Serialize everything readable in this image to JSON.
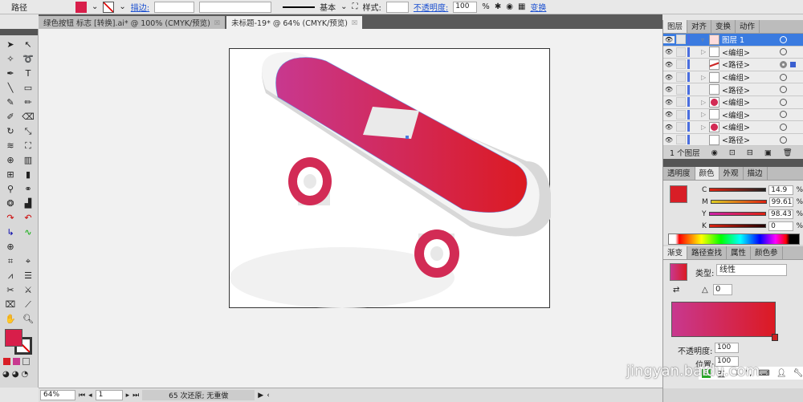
{
  "control_bar": {
    "object_type": "路径",
    "stroke_label": "描边:",
    "stroke_style": "基本",
    "style_label": "样式:",
    "opacity_label": "不透明度:",
    "opacity_value": "100",
    "percent": "%",
    "transform_label": "变换"
  },
  "doc_tabs": [
    {
      "label": "绿色按钮 标志 [转换].ai* @ 100% (CMYK/预览)",
      "active": false
    },
    {
      "label": "未标题-19* @ 64% (CMYK/预览)",
      "active": true
    }
  ],
  "layers_panel": {
    "tabs": [
      "图层",
      "对齐",
      "变换",
      "动作"
    ],
    "items": [
      "图层 1",
      "<编组>",
      "<路径>",
      "<编组>",
      "<路径>",
      "<编组>",
      "<编组>",
      "<编组>",
      "<路径>"
    ],
    "footer": "1 个图层"
  },
  "color_panel": {
    "tabs": [
      "透明度",
      "颜色",
      "外观",
      "描边"
    ],
    "channels": [
      {
        "label": "C",
        "value": "14.9"
      },
      {
        "label": "M",
        "value": "99.61"
      },
      {
        "label": "Y",
        "value": "98.43"
      },
      {
        "label": "K",
        "value": "0"
      }
    ],
    "fill_color": "#d81e26"
  },
  "gradient_panel": {
    "tabs": [
      "渐变",
      "路径查找",
      "属性",
      "颜色参"
    ],
    "type_label": "类型:",
    "type_value": "线性",
    "angle": "0",
    "opacity_label": "不透明度:",
    "opacity_value": "100",
    "location_label": "位置:",
    "location_value": "100",
    "start_color": "#c8388f",
    "end_color": "#dc1a22"
  },
  "status_bar": {
    "zoom": "64%",
    "page": "1",
    "message": "65 次还原; 无重做"
  },
  "watermark": "jingyan.baidu.com",
  "ime": "五"
}
